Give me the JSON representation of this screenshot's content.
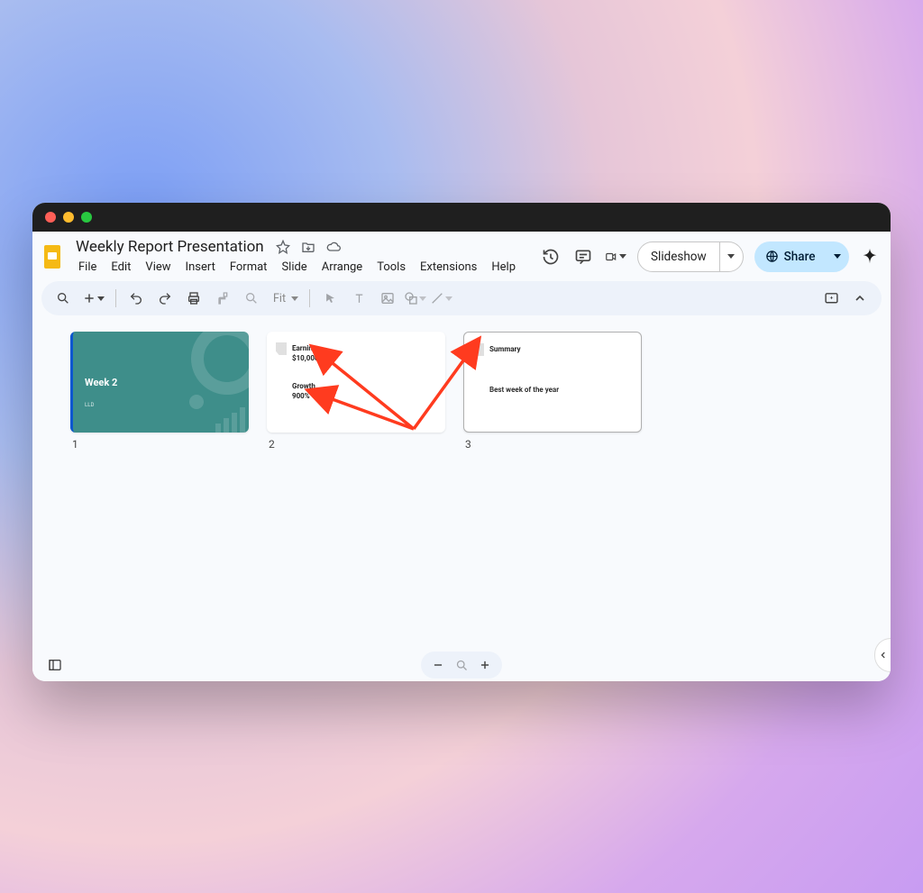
{
  "doc": {
    "title": "Weekly Report Presentation"
  },
  "menus": [
    "File",
    "Edit",
    "View",
    "Insert",
    "Format",
    "Slide",
    "Arrange",
    "Tools",
    "Extensions",
    "Help"
  ],
  "header_actions": {
    "slideshow_label": "Slideshow",
    "share_label": "Share"
  },
  "toolbar": {
    "zoom_label": "Fit"
  },
  "slides": [
    {
      "number": "1",
      "layout": "title",
      "title": "Week 2",
      "subtitle": "LLD"
    },
    {
      "number": "2",
      "layout": "content",
      "heading1": "Earnings",
      "value1": "$10,000",
      "heading2": "Growth",
      "value2": "900%"
    },
    {
      "number": "3",
      "layout": "content",
      "heading1": "Summary",
      "body": "Best week of the year"
    }
  ],
  "annotation": {
    "type": "arrows",
    "color": "#ff3b1f",
    "origin_slide": 2,
    "targets": [
      "slide2.heading1",
      "slide2.heading2",
      "slide3.heading1"
    ]
  }
}
